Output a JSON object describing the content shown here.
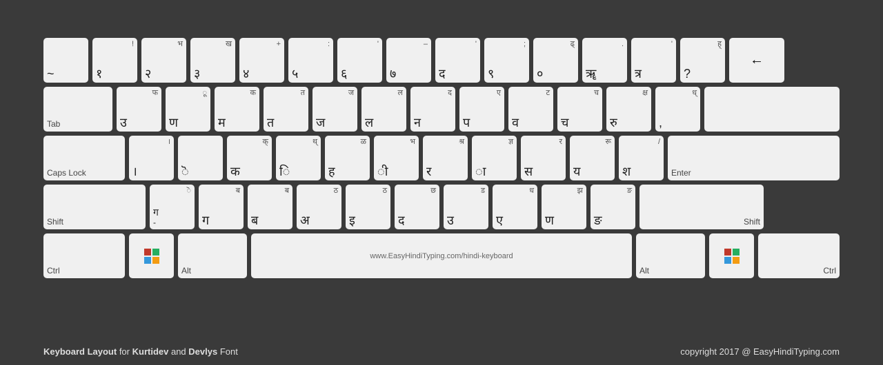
{
  "keyboard": {
    "rows": [
      {
        "keys": [
          {
            "label": "",
            "main": "~",
            "top": "",
            "w": "w1"
          },
          {
            "label": "",
            "main": "१",
            "top": "!",
            "w": "w1"
          },
          {
            "label": "",
            "main": "भ\n२",
            "top": "",
            "w": "w1"
          },
          {
            "label": "",
            "main": "ख\n३",
            "top": "",
            "w": "w1"
          },
          {
            "label": "",
            "main": "४",
            "top": "+",
            "w": "w1"
          },
          {
            "label": "",
            "main": "५",
            "top": ":",
            "w": "w1"
          },
          {
            "label": "",
            "main": "६",
            "top": "'",
            "w": "w1"
          },
          {
            "label": "",
            "main": "७",
            "top": "–",
            "w": "w1"
          },
          {
            "label": "",
            "main": "द",
            "top": "'",
            "w": "w1"
          },
          {
            "label": "",
            "main": "९",
            "top": ";",
            "w": "w1"
          },
          {
            "label": "",
            "main": "०",
            "top": "ढ्",
            "w": "w1"
          },
          {
            "label": "",
            "main": "ॠ",
            "top": ".",
            "w": "w1"
          },
          {
            "label": "",
            "main": "त्र",
            "top": "'",
            "w": "w1"
          },
          {
            "label": "",
            "main": "?",
            "top": "ह्",
            "w": "w1"
          },
          {
            "label": "",
            "main": "←",
            "top": "",
            "w": "w-back"
          }
        ]
      },
      {
        "keys": [
          {
            "label": "Tab",
            "main": "",
            "top": "",
            "w": "w-tab"
          },
          {
            "label": "",
            "main": "फ\nउ",
            "top": "ु",
            "w": "w1"
          },
          {
            "label": "",
            "main": "ू\nण",
            "top": "",
            "w": "w1"
          },
          {
            "label": "",
            "main": "म",
            "top": "क",
            "w": "w1"
          },
          {
            "label": "",
            "main": "त",
            "top": "त",
            "w": "w1"
          },
          {
            "label": "",
            "main": "ज",
            "top": "ज",
            "w": "w1"
          },
          {
            "label": "",
            "main": "ल",
            "top": "ल",
            "w": "w1"
          },
          {
            "label": "",
            "main": "न",
            "top": "द",
            "w": "w1"
          },
          {
            "label": "",
            "main": "प",
            "top": "ए",
            "w": "w1"
          },
          {
            "label": "",
            "main": "व",
            "top": "ट",
            "w": "w1"
          },
          {
            "label": "",
            "main": "च",
            "top": "च",
            "w": "w1"
          },
          {
            "label": "",
            "main": "रु",
            "top": "क्ष",
            "w": "w1"
          },
          {
            "label": "",
            "main": "ध्\n,",
            "top": "",
            "w": "w1"
          },
          {
            "label": "",
            "main": "",
            "top": "",
            "w": "w-enter",
            "isEnter": false,
            "flex": true
          }
        ]
      },
      {
        "keys": [
          {
            "label": "Caps Lock",
            "main": "",
            "top": "",
            "w": "w-caps"
          },
          {
            "label": "",
            "main": "।",
            "top": "।",
            "w": "w1"
          },
          {
            "label": "",
            "main": "ॆ",
            "top": "",
            "w": "w1"
          },
          {
            "label": "",
            "main": "क",
            "top": "क्",
            "w": "w1"
          },
          {
            "label": "",
            "main": "ि",
            "top": "थ्",
            "w": "w1"
          },
          {
            "label": "",
            "main": "ह",
            "top": "ळ",
            "w": "w1"
          },
          {
            "label": "",
            "main": "ी",
            "top": "भ",
            "w": "w1"
          },
          {
            "label": "",
            "main": "र",
            "top": "श्र",
            "w": "w1"
          },
          {
            "label": "",
            "main": "ा",
            "top": "ज्ञ",
            "w": "w1"
          },
          {
            "label": "",
            "main": "स",
            "top": "र",
            "w": "w1"
          },
          {
            "label": "",
            "main": "य",
            "top": "रू",
            "w": "w1"
          },
          {
            "label": "",
            "main": "श",
            "top": "/",
            "w": "w1"
          },
          {
            "label": "Enter",
            "main": "",
            "top": "",
            "w": "w-enter"
          }
        ]
      },
      {
        "keys": [
          {
            "label": "Shift",
            "main": "",
            "top": "",
            "w": "w-shift-l"
          },
          {
            "label": "",
            "main": "ग\n-",
            "top": "ॆ",
            "w": "w1"
          },
          {
            "label": "",
            "main": "ग",
            "top": "ब",
            "w": "w1"
          },
          {
            "label": "",
            "main": "ब",
            "top": "ब",
            "w": "w1"
          },
          {
            "label": "",
            "main": "अ",
            "top": "ठ",
            "w": "w1"
          },
          {
            "label": "",
            "main": "इ",
            "top": "ठ",
            "w": "w1"
          },
          {
            "label": "",
            "main": "द",
            "top": "छ",
            "w": "w1"
          },
          {
            "label": "",
            "main": "उ",
            "top": "ड",
            "w": "w1"
          },
          {
            "label": "",
            "main": "ए",
            "top": "ध",
            "w": "w1"
          },
          {
            "label": "",
            "main": "ण",
            "top": "झ",
            "w": "w1"
          },
          {
            "label": "",
            "main": "ङ",
            "top": "ङ",
            "w": "w1"
          },
          {
            "label": "Shift",
            "main": "",
            "top": "",
            "w": "w-shift-r"
          }
        ]
      },
      {
        "keys": [
          {
            "label": "Ctrl",
            "main": "",
            "top": "",
            "w": "w-ctrl"
          },
          {
            "label": "win",
            "main": "",
            "top": "",
            "w": "w-win",
            "isWin": true
          },
          {
            "label": "Alt",
            "main": "",
            "top": "",
            "w": "w-alt"
          },
          {
            "label": "www.EasyHindiTyping.com/hindi-keyboard",
            "main": "",
            "top": "",
            "w": "w-space",
            "isSpace": true
          },
          {
            "label": "Alt",
            "main": "",
            "top": "",
            "w": "w-alt"
          },
          {
            "label": "win",
            "main": "",
            "top": "",
            "w": "w-win",
            "isWin": true
          },
          {
            "label": "Ctrl",
            "main": "",
            "top": "",
            "w": "w-ctrl"
          }
        ]
      }
    ],
    "footer": {
      "left": "Keyboard Layout for Kurtidev and Devlys Font",
      "right": "copyright 2017 @ EasyHindiTyping.com"
    }
  }
}
